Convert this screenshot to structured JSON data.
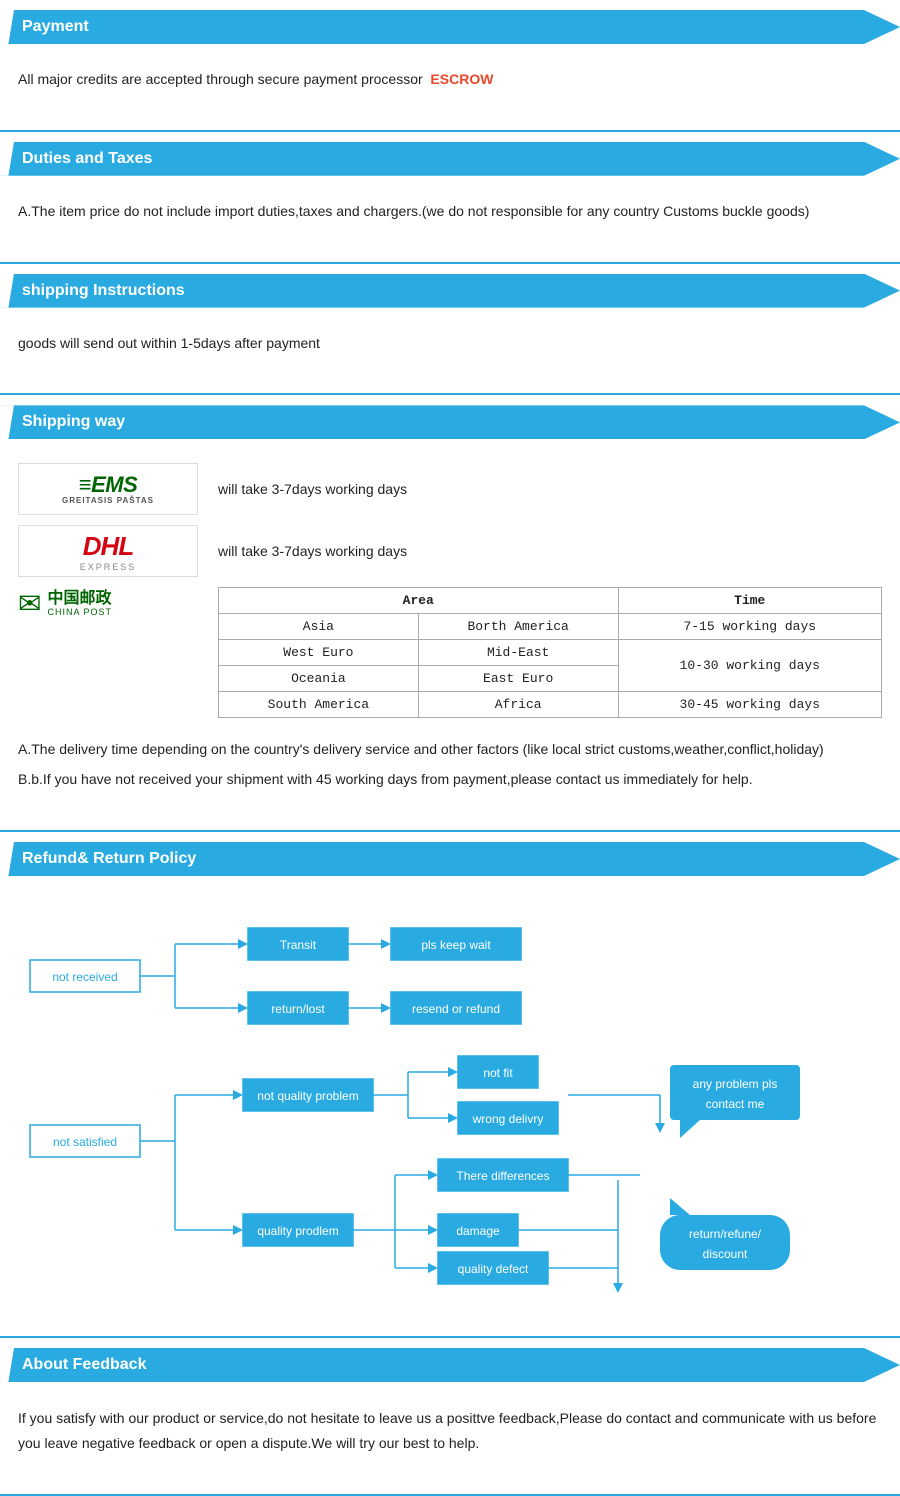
{
  "sections": {
    "payment": {
      "title": "Payment",
      "body": "All  major  credits  are  accepted  through  secure  payment  processor",
      "escrow": "ESCROW"
    },
    "duties": {
      "title": "Duties  and  Taxes",
      "body": "A.The  item  price  do  not  include  import  duties,taxes  and  chargers.(we  do  not  responsible  for  any  country  Customs  buckle  goods)"
    },
    "shipping_instructions": {
      "title": "shipping  Instructions",
      "body": "goods  will  send  out  within  1-5days  after  payment"
    },
    "shipping_way": {
      "title": "Shipping  way",
      "ems_label": "will  take  3-7days  working  days",
      "dhl_label": "will  take  3-7days  working  days",
      "table": {
        "headers": [
          "Area",
          "",
          "Time"
        ],
        "rows": [
          [
            "Asia",
            "Borth America",
            "7-15 working days"
          ],
          [
            "West Euro",
            "Mid-East",
            "10-30 working days"
          ],
          [
            "Oceania",
            "East Euro",
            ""
          ],
          [
            "South America",
            "Africa",
            "30-45 working days"
          ]
        ]
      },
      "note1": "A.The  delivery  time  depending  on  the  country's  delivery  service  and  other  factors  (like  local strict  customs,weather,conflict,holiday)",
      "note2": "B.b.If  you  have  not  received  your  shipment  with  45  working  days  from  payment,please  contact us  immediately  for  help."
    },
    "refund": {
      "title": "Refund&  Return  Policy",
      "nodes": {
        "not_received": "not  received",
        "transit": "Transit",
        "pls_keep_wait": "pls  keep  wait",
        "return_lost": "return/lost",
        "resend_or_refund": "resend  or  refund",
        "not_satisfied": "not  satisfied",
        "not_quality_problem": "not  quality  problem",
        "not_fit": "not  fit",
        "wrong_delivery": "wrong  delivry",
        "quality_prodlem": "quality  prodlem",
        "there_differences": "There  differences",
        "damage": "damage",
        "quality_defect": "quality  defect",
        "any_problem": "any  problem  pls contact  me",
        "return_refund": "return/refune/ discount"
      }
    },
    "feedback": {
      "title": "About  Feedback",
      "body": "If  you  satisfy  with  our  product  or  service,do  not  hesitate  to  leave  us  a  posittve  feedback,Please do  contact  and  communicate  with  us  before  you  leave  negative  feedback  or  open  a  dispute.We will  try  our  best  to  help."
    }
  },
  "colors": {
    "blue": "#29abe2",
    "red": "#e8472a",
    "green": "#006400",
    "border": "#29abe2"
  }
}
